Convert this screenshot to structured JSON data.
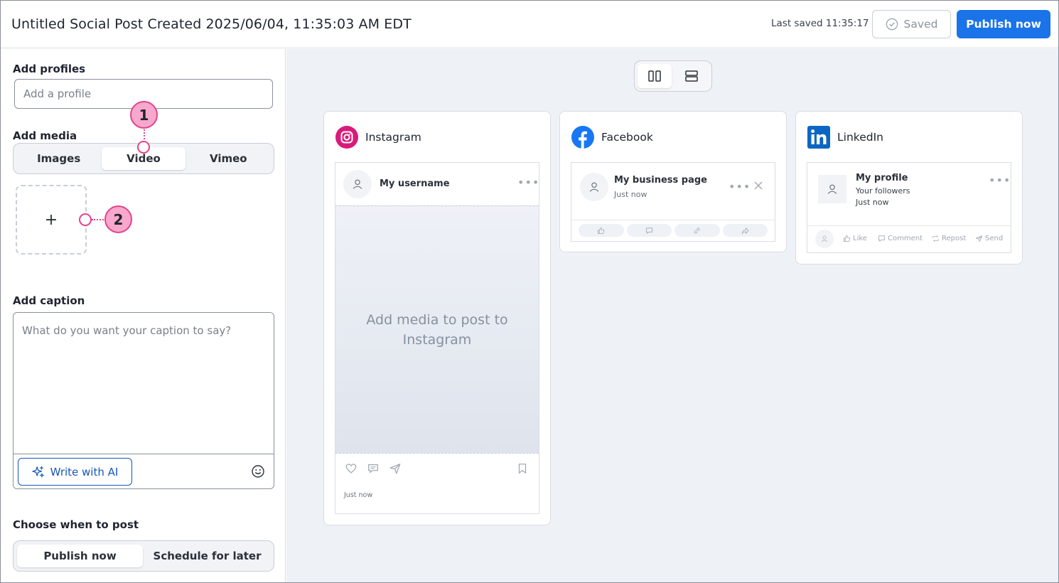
{
  "header": {
    "title": "Untitled Social Post Created 2025/06/04, 11:35:03 AM EDT",
    "last_saved": "Last saved 11:35:17",
    "saved_label": "Saved",
    "publish_label": "Publish now"
  },
  "left": {
    "profiles_label": "Add profiles",
    "profiles_placeholder": "Add a profile",
    "media_label": "Add media",
    "media_tabs": [
      "Images",
      "Video",
      "Vimeo"
    ],
    "media_active": "Video",
    "add_media_symbol": "+",
    "caption_label": "Add caption",
    "caption_placeholder": "What do you want your caption to say?",
    "ai_button": "Write with AI",
    "when_label": "Choose when to post",
    "when_tabs": [
      "Publish now",
      "Schedule for later"
    ],
    "when_active": "Publish now"
  },
  "annotations": [
    "1",
    "2"
  ],
  "previews": {
    "instagram": {
      "name": "Instagram",
      "username": "My username",
      "placeholder": "Add media to post to Instagram",
      "time": "Just now"
    },
    "facebook": {
      "name": "Facebook",
      "page": "My business page",
      "time": "Just now"
    },
    "linkedin": {
      "name": "LinkedIn",
      "profile": "My profile",
      "followers": "Your followers",
      "time": "Just now",
      "actions": [
        "Like",
        "Comment",
        "Repost",
        "Send"
      ]
    }
  },
  "colors": {
    "accent": "#1a73e8",
    "annotation_fill": "#f8a8cc",
    "annotation_stroke": "#e2448a",
    "facebook": "#1877f2",
    "linkedin": "#0a66c2",
    "instagram": "#d81b7a"
  }
}
